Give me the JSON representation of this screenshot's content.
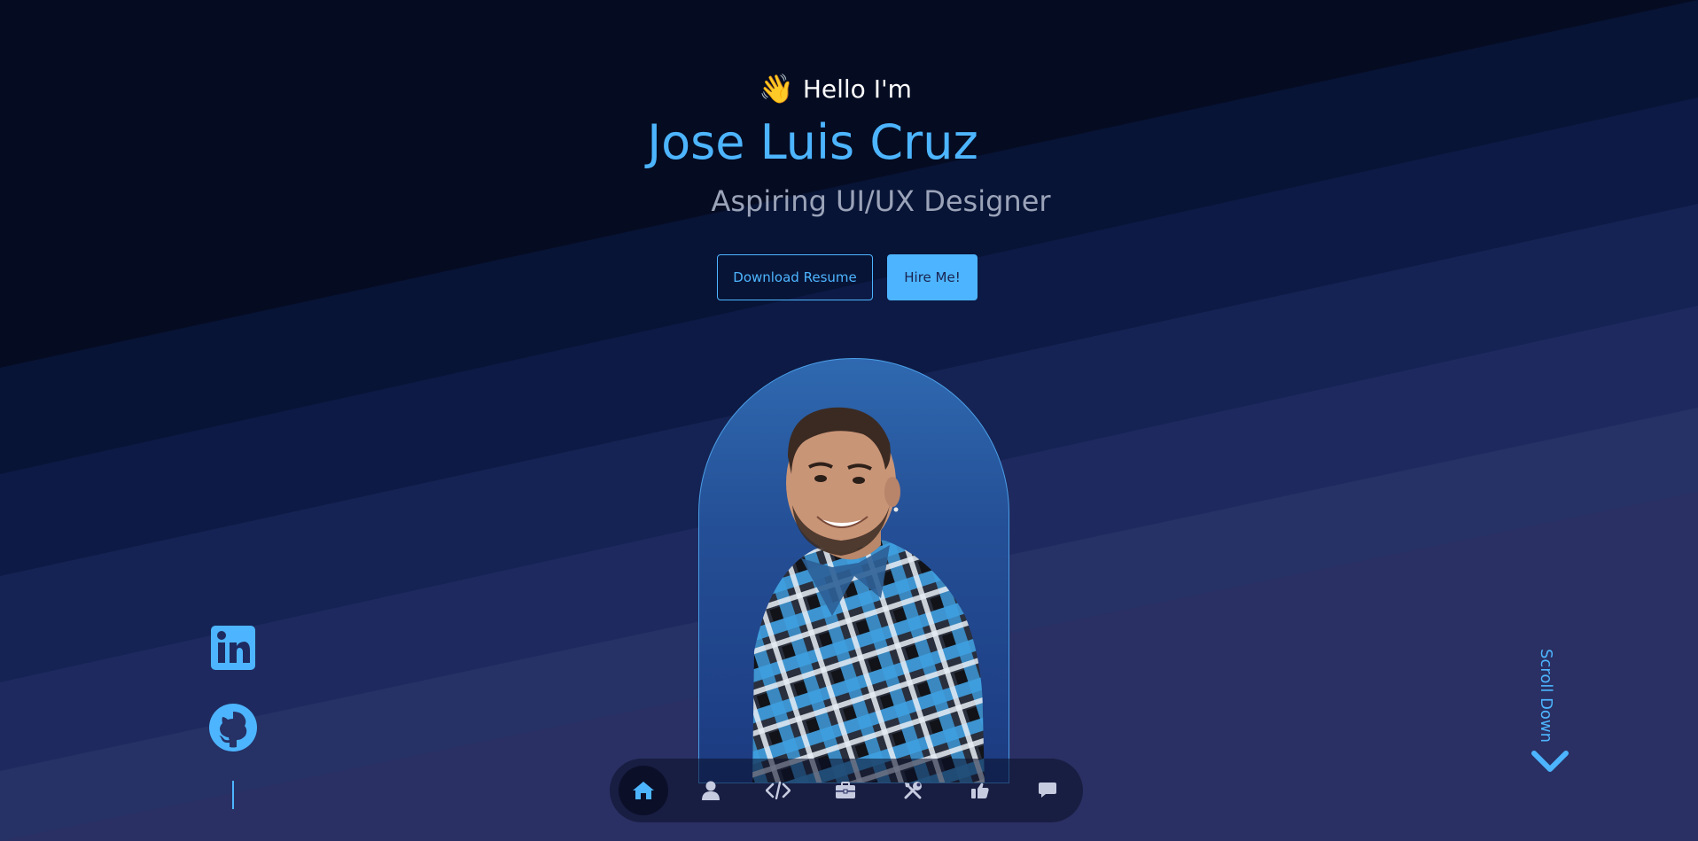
{
  "hero": {
    "greeting": "Hello I'm",
    "name": "Jose Luis Cruz",
    "role": "Aspiring UI/UX Designer"
  },
  "buttons": {
    "download_resume": "Download Resume",
    "hire_me": "Hire Me!"
  },
  "socials": [
    {
      "icon": "linkedin-icon"
    },
    {
      "icon": "github-icon"
    }
  ],
  "scroll": {
    "label": "Scroll Down",
    "icon": "chevron-down-icon"
  },
  "nav": {
    "active": "home",
    "items": [
      {
        "id": "home",
        "icon": "home-icon"
      },
      {
        "id": "about",
        "icon": "user-icon"
      },
      {
        "id": "code",
        "icon": "code-icon"
      },
      {
        "id": "experience",
        "icon": "briefcase-icon"
      },
      {
        "id": "services",
        "icon": "tools-icon"
      },
      {
        "id": "testimonials",
        "icon": "thumbs-up-icon"
      },
      {
        "id": "contact",
        "icon": "chat-icon"
      }
    ]
  },
  "colors": {
    "accent": "#4db5ff",
    "background": "#050c22",
    "muted_text": "#9aa3b8",
    "nav_icon": "#c6cbe0"
  }
}
